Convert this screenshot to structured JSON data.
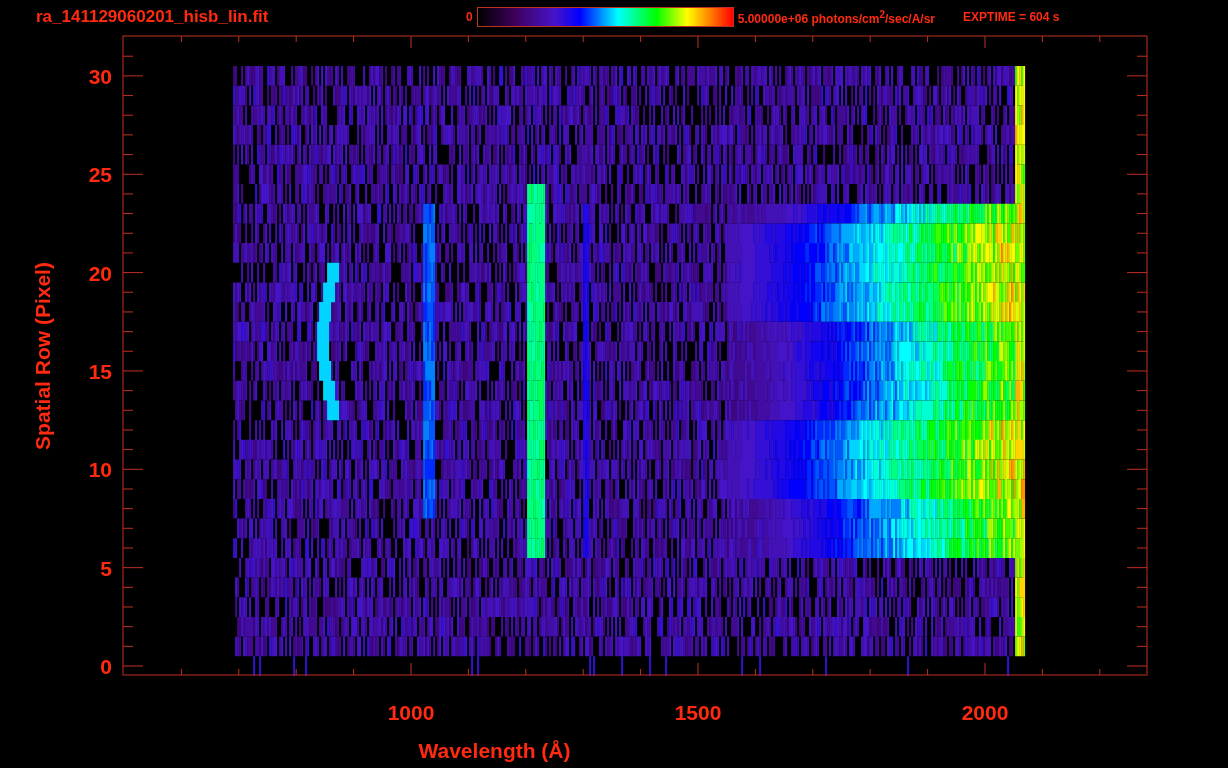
{
  "title": "ra_141129060201_hisb_lin.fit",
  "colorbar": {
    "min_label": "0",
    "max_label": "5.00000e+06 photons/cm$^{2}$/sec/A/sr"
  },
  "exposure": "EXPTIME = 604 s",
  "x_axis": {
    "label": "Wavelength (Å)",
    "ticks": [
      "1000",
      "1500",
      "2000"
    ]
  },
  "y_axis": {
    "label": "Spatial Row (Pixel)",
    "ticks": [
      "30",
      "25",
      "20",
      "15",
      "10",
      "5",
      "0"
    ]
  }
}
